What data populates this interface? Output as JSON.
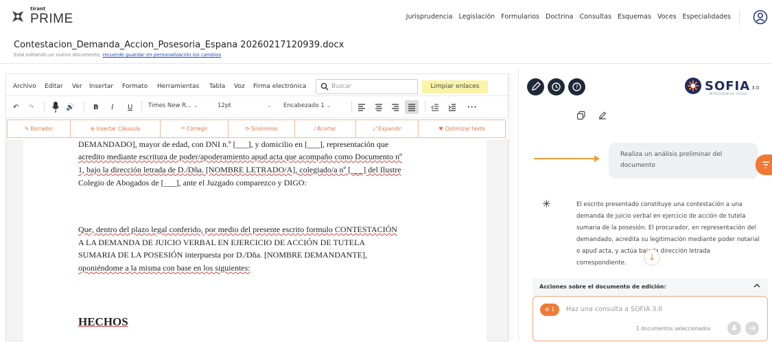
{
  "header": {
    "logo_small": "tirant",
    "logo_big": "PRIME",
    "nav": [
      "Jurisprudencia",
      "Legislación",
      "Formularios",
      "Doctrina",
      "Consultas",
      "Esquemas",
      "Voces",
      "Especialidades"
    ]
  },
  "document": {
    "filename": "Contestacion_Demanda_Accion_Posesoria_Espana 20260217120939.docx",
    "notice": "Está editando un nuevo documento,",
    "notice_link": "recuerde guardar en personalización los cambios"
  },
  "editor": {
    "menu": [
      "Archivo",
      "Editar",
      "Ver",
      "Insertar",
      "Formato",
      "Herramientas",
      "Tabla",
      "Voz",
      "Firma electrónica"
    ],
    "search_placeholder": "Buscar",
    "clear_links": "Limpiar enlaces",
    "font_family": "Times New R...",
    "font_size": "12pt",
    "heading": "Encabezado 1",
    "actions": [
      "Borrador",
      "Insertar Cláusula",
      "Corregir",
      "Sinónimos",
      "Acortar",
      "Expandir",
      "Optimizar texto"
    ],
    "lines": [
      "DEMANDADO], mayor de edad, con DNI n.º [___], y domicilio en [___], representación que",
      "acredito mediante escritura de poder/apoderamiento apud acta que acompaño como Documento nº",
      "1, bajo la dirección letrada de D./Dña. [NOMBRE LETRADO/A], colegiado/a nº [___] del Ilustre",
      "Colegio de Abogados de [___], ante el Juzgado comparezco y DIGO:",
      "Que, dentro del plazo legal conferido, por medio del presente escrito formulo CONTESTACIÓN",
      "A LA DEMANDA DE JUICIO VERBAL EN EJERCICIO DE ACCIÓN DE TUTELA",
      "SUMARIA DE LA POSESIÓN interpuesta por D./Dña. [NOMBRE DEMANDANTE],",
      "oponiéndome a la misma con base en los siguientes:"
    ],
    "heading_text": "HECHOS"
  },
  "sofia": {
    "name": "SOFIA",
    "version": "3.0",
    "tagline": "INTELIGENCIA LEGAL",
    "user_message": "Realiza un análisis preliminar del documento",
    "answer": "El escrito presentado constituye una contestación a una demanda de juicio verbal en ejercicio de acción de tutela sumaria de la posesión. El procurador, en representación del demandado, acredita su legitimación mediante poder notarial o apud acta, y actúa bajo la dirección letrada correspondiente.",
    "actions_label": "Acciones sobre el documento de edición:",
    "query_badge": "1",
    "query_placeholder": "Haz una consulta a SOFIA 3.0",
    "selected_docs": "1 documentos seleccionados"
  },
  "colors": {
    "accent": "#f07a35",
    "brand": "#1f2b5c",
    "dark": "#1f2937"
  }
}
